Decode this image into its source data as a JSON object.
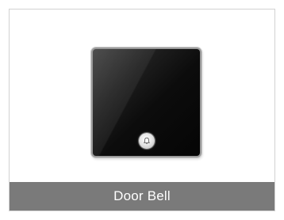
{
  "product": {
    "name": "Door Bell",
    "button_icon": "bell-icon"
  },
  "colors": {
    "caption_bar": "#7a7a7a",
    "caption_text": "#ffffff",
    "device_face": "#0c0c0c",
    "card_border": "#d2d2d2"
  }
}
